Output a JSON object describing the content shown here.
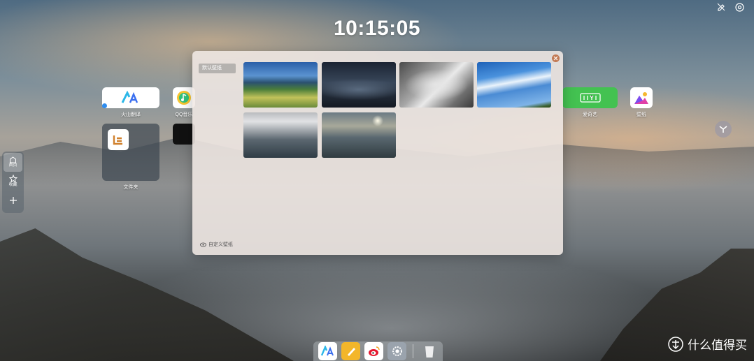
{
  "clock": {
    "time": "10:15:05"
  },
  "top_icons": [
    {
      "name": "edit-wallpaper-icon"
    },
    {
      "name": "settings-icon"
    }
  ],
  "side_dock": {
    "items": [
      {
        "name": "home",
        "label": "首页",
        "icon": "home-icon",
        "active": true
      },
      {
        "name": "favorites",
        "label": "收藏",
        "icon": "star-icon",
        "active": false
      },
      {
        "name": "add",
        "label": "",
        "icon": "plus-icon",
        "active": false
      }
    ]
  },
  "apps": [
    {
      "name": "huoshan-translate",
      "label": "火山翻译",
      "color": "#ffffff"
    },
    {
      "name": "qq-music",
      "label": "QQ音乐",
      "color": "#ffffff"
    },
    {
      "name": "folder",
      "label": "文件夹",
      "color": "#3c4650"
    },
    {
      "name": "iqiyi",
      "label": "爱奇艺",
      "color": "#43c251"
    },
    {
      "name": "wallpaper",
      "label": "壁纸",
      "color": "#ffffff"
    }
  ],
  "wallpaper_panel": {
    "tab_label": "默认壁纸",
    "footer_label": "自定义壁纸",
    "thumbnails": [
      {
        "name": "lake-mountain"
      },
      {
        "name": "dunes"
      },
      {
        "name": "waves-aerial"
      },
      {
        "name": "clouds-sky"
      },
      {
        "name": "cloudy-sea"
      },
      {
        "name": "sunset-coast"
      }
    ]
  },
  "bottom_dock": {
    "items": [
      {
        "name": "huoshan-translate",
        "icon": "translate-icon"
      },
      {
        "name": "notes",
        "icon": "notes-icon"
      },
      {
        "name": "weibo",
        "icon": "weibo-icon"
      },
      {
        "name": "system-settings",
        "icon": "gear-icon"
      },
      {
        "name": "trash",
        "icon": "trash-icon"
      }
    ]
  },
  "watermark": {
    "text": "什么值得买"
  }
}
